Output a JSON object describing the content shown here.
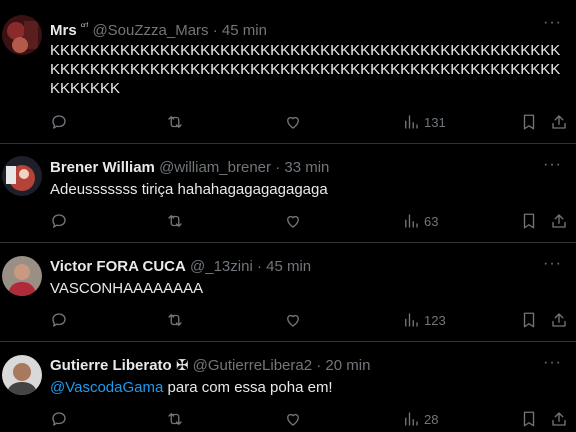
{
  "tweets": [
    {
      "name": "Mrs",
      "name_suffix": "ᶜʳᶠ",
      "handle": "@SouZzza_Mars",
      "sep": "·",
      "time": "45 min",
      "text": "KKKKKKKKKKKKKKKKKKKKKKKKKKKKKKKKKKKKKKKKKKKKKKKKKKKKKKKKKKKKKKKKKKKKKKKKKKKKKKKKKKKKKKKKKKKKKKKKKKKKKKKKKKKKK",
      "views": "131"
    },
    {
      "name": "Brener William",
      "handle": "@william_brener",
      "sep": "·",
      "time": "33 min",
      "text": "Adeusssssss tiriça hahahagagagagagaga",
      "views": "63"
    },
    {
      "name": "Victor FORA CUCA",
      "handle": "@_13zini",
      "sep": "·",
      "time": "45 min",
      "text": "VASCONHAAAAAAAA",
      "views": "123"
    },
    {
      "name": "Gutierre Liberato",
      "name_badge": "✠",
      "handle": "@GutierreLibera2",
      "sep": "·",
      "time": "20 min",
      "mention": "@VascodaGama",
      "text": "para com essa poha em!",
      "views": "28"
    }
  ],
  "icons": {
    "reply": "reply-icon",
    "retweet": "retweet-icon",
    "like": "heart-icon",
    "views": "views-icon",
    "bookmark": "bookmark-icon",
    "share": "share-icon",
    "more": "more-icon"
  },
  "colors": {
    "background": "#000000",
    "text": "#e7e9ea",
    "muted": "#71767b",
    "link": "#1d9bf0",
    "divider": "#2f3336"
  }
}
